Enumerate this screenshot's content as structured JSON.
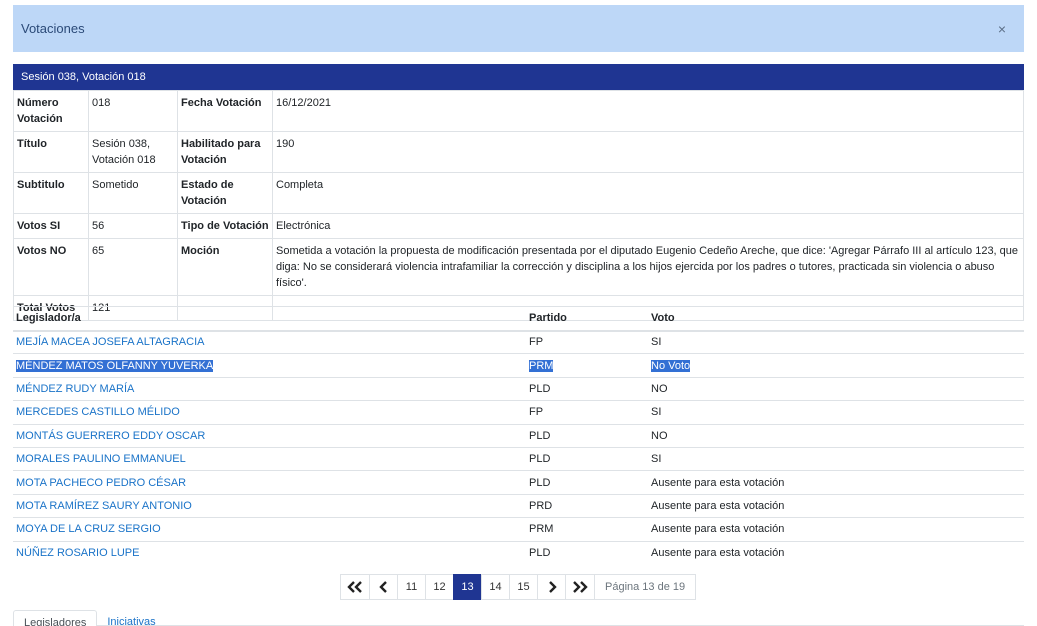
{
  "modal": {
    "title": "Votaciones",
    "close": "×"
  },
  "session_header": "Sesión 038, Votación 018",
  "info": {
    "numero_label": "Número Votación",
    "numero_value": "018",
    "fecha_label": "Fecha Votación",
    "fecha_value": "16/12/2021",
    "titulo_label": "Título",
    "titulo_value": "Sesión 038, Votación 018",
    "habilitado_label": "Habilitado para Votación",
    "habilitado_value": "190",
    "subtitulo_label": "Subtitulo",
    "subtitulo_value": "Sometido",
    "estado_label": "Estado de Votación",
    "estado_value": "Completa",
    "votos_si_label": "Votos SI",
    "votos_si_value": "56",
    "tipo_label": "Tipo de Votación",
    "tipo_value": "Electrónica",
    "votos_no_label": "Votos NO",
    "votos_no_value": "65",
    "mocion_label": "Moción",
    "mocion_value": "Sometida a votación la propuesta de modificación presentada por el diputado Eugenio Cedeño Areche, que dice: 'Agregar Párrafo III al artículo 123, que diga: No se considerará violencia intrafamiliar la corrección y disciplina a los hijos ejercida por los padres o tutores, practicada sin violencia o abuso físico'.",
    "total_label": "Total Votos",
    "total_value": "121"
  },
  "votes_table": {
    "headers": {
      "legislador": "Legislador/a",
      "partido": "Partido",
      "voto": "Voto"
    },
    "rows": [
      {
        "name": "MEJÍA MACEA JOSEFA ALTAGRACIA",
        "party": "FP",
        "vote": "SI"
      },
      {
        "name": "MÉNDEZ MATOS OLFANNY YUVERKA",
        "party": "PRM",
        "vote": "No Voto"
      },
      {
        "name": "MÉNDEZ RUDY MARÍA",
        "party": "PLD",
        "vote": "NO"
      },
      {
        "name": "MERCEDES CASTILLO MÉLIDO",
        "party": "FP",
        "vote": "SI"
      },
      {
        "name": "MONTÁS GUERRERO EDDY OSCAR",
        "party": "PLD",
        "vote": "NO"
      },
      {
        "name": "MORALES PAULINO EMMANUEL",
        "party": "PLD",
        "vote": "SI"
      },
      {
        "name": "MOTA PACHECO PEDRO CÉSAR",
        "party": "PLD",
        "vote": "Ausente para esta votación"
      },
      {
        "name": "MOTA RAMÍREZ SAURY ANTONIO",
        "party": "PRD",
        "vote": "Ausente para esta votación"
      },
      {
        "name": "MOYA DE LA CRUZ SERGIO",
        "party": "PRM",
        "vote": "Ausente para esta votación"
      },
      {
        "name": "NÚÑEZ ROSARIO LUPE",
        "party": "PLD",
        "vote": "Ausente para esta votación"
      }
    ]
  },
  "pagination": {
    "pages": [
      "11",
      "12",
      "13",
      "14",
      "15"
    ],
    "current": "13",
    "info": "Página 13 de 19",
    "icons": [
      "double-chevron-left-icon",
      "chevron-left-icon",
      "chevron-right-icon",
      "double-chevron-right-icon"
    ]
  },
  "tabs": {
    "legisladores": "Legisladores",
    "iniciativas": "Iniciativas"
  },
  "colors": {
    "header_bg": "#bdd7f7",
    "session_bar": "#1f3592",
    "link": "#1a73c8",
    "selection": "#3370d4"
  }
}
